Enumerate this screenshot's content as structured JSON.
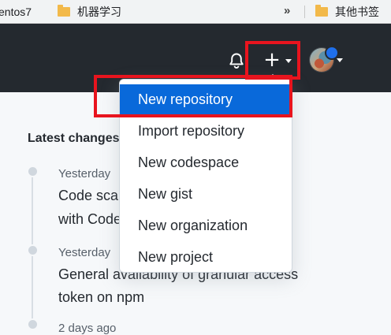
{
  "bookmarks_bar": {
    "items": [
      {
        "label": "entos7"
      },
      {
        "label": "机器学习"
      },
      {
        "label": "其他书签"
      }
    ],
    "overflow_label": "»"
  },
  "header": {
    "notification_icon": "bell-icon",
    "create_label": "+",
    "avatar_icon": "avatar",
    "colors": {
      "background": "#24292f",
      "highlight": "#e8141e"
    }
  },
  "create_menu": {
    "items": [
      {
        "label": "New repository",
        "selected": true
      },
      {
        "label": "Import repository"
      },
      {
        "label": "New codespace"
      },
      {
        "label": "New gist"
      },
      {
        "label": "New organization"
      },
      {
        "label": "New project"
      }
    ],
    "accent_color": "#0969da"
  },
  "feed": {
    "title": "Latest changes",
    "entries": [
      {
        "date": "Yesterday",
        "lines": [
          "Code scanning default setup",
          "with CodeQL"
        ]
      },
      {
        "date": "Yesterday",
        "lines": [
          "General availability of granular access",
          "token on npm"
        ]
      },
      {
        "date": "2 days ago"
      }
    ]
  }
}
